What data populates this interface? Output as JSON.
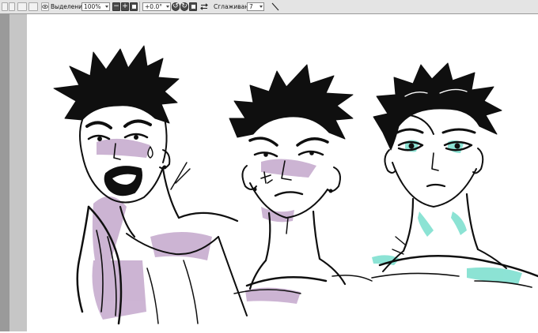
{
  "toolbar": {
    "selection_label": "Выделение",
    "zoom_value": "100%",
    "angle_value": "+0.0°",
    "smoothing_label": "Сглаживание",
    "smoothing_value": "7",
    "icons": [
      "blank-square-icon",
      "blank-square-icon",
      "blank-square-icon",
      "blank-square-icon",
      "visibility-eye-icon",
      "zoom-out-icon",
      "zoom-in-icon",
      "zoom-fit-icon",
      "rotate-ccw-icon",
      "rotate-cw-icon",
      "rotate-reset-icon",
      "flip-horizontal-icon",
      "pen-nib-icon"
    ]
  },
  "canvas": {
    "content": "sketch of three character heads",
    "ink_color": "#0f0f0f",
    "accent_colors": {
      "lilac": "#c4a8cc",
      "teal": "#80e0d0"
    }
  }
}
